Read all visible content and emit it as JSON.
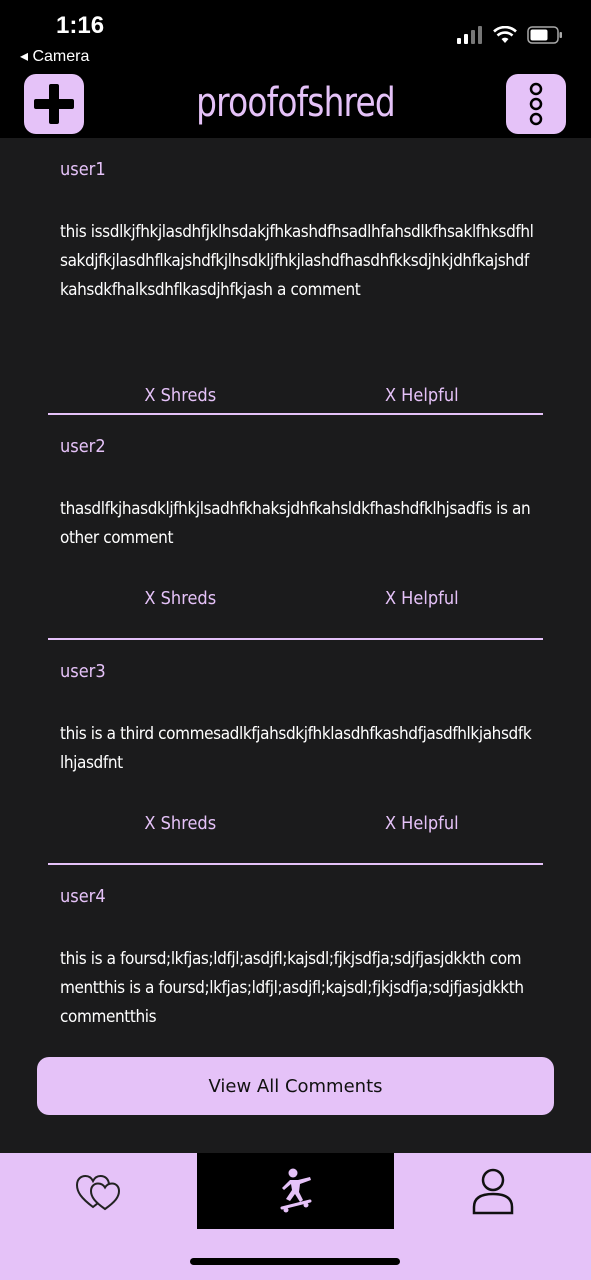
{
  "status": {
    "time": "1:16",
    "back_app": "◂ Camera"
  },
  "header": {
    "title": "proofofshred",
    "add_icon": "plus-icon",
    "menu_icon": "vertical-dots-icon"
  },
  "comments": [
    {
      "user": "user1",
      "text": "this issdlkjfhkjlasdhfjklhsdakjfhkashdfhsadlhfahsdlkfhsaklfhksdfhlsakdjfkjlasdhflkajshdfkjlhsdkljfhkjlashdfhasdhfkksdjhkjdhfkajshdfkahsdkfhalksdhflkasdjhfkjash a comment",
      "shreds": "X Shreds",
      "helpful": "X Helpful"
    },
    {
      "user": "user2",
      "text": "thasdlfkjhasdkljfhkjlsadhfkhaksjdhfkahsldkfhashdfklhjsadfis is another comment",
      "shreds": "X Shreds",
      "helpful": "X Helpful"
    },
    {
      "user": "user3",
      "text": "this is a third commesadlkfjahsdkjfhklasdhfkashdfjasdfhlkjahsdfklhjasdfnt",
      "shreds": "X Shreds",
      "helpful": "X Helpful"
    },
    {
      "user": "user4",
      "text": "this is a foursd;lkfjas;ldfjl;asdjfl;kajsdl;fjkjsdfja;sdjfjasjdkkth commentthis is a foursd;lkfjas;ldfjl;asdjfl;kajsdl;fjkjsdfja;sdjfjasjdkkth commentthis",
      "shreds": "",
      "helpful": ""
    }
  ],
  "view_all_label": "View All Comments",
  "tabs": {
    "favorites_icon": "hearts-icon",
    "shred_icon": "skateboarder-icon",
    "profile_icon": "user-icon"
  },
  "colors": {
    "accent": "#e5c2f8",
    "background": "#000000",
    "feed_background": "#1b1b1c"
  }
}
